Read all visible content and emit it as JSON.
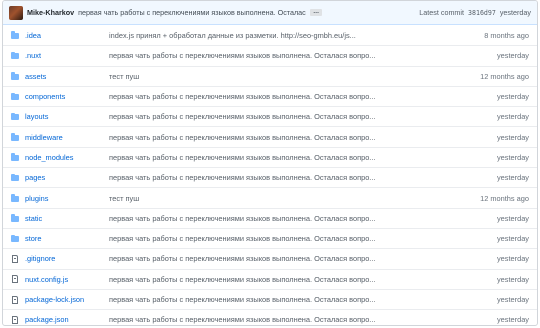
{
  "commit": {
    "author": "Mike-Kharkov",
    "message": "первая чать работы с переключениями языков выполнена. Осталася вопро...",
    "more_label": "…",
    "latest_label": "Latest commit",
    "sha": "3816d97",
    "when": "yesterday"
  },
  "files": [
    {
      "type": "dir",
      "name": ".idea",
      "message": "index.js принял + обработал данные из разметки. http://seo-gmbh.eu/js...",
      "age": "8 months ago"
    },
    {
      "type": "dir",
      "name": ".nuxt",
      "message": "первая чать работы с переключениями языков выполнена. Осталася вопро...",
      "age": "yesterday"
    },
    {
      "type": "dir",
      "name": "assets",
      "message": "тест пуш",
      "age": "12 months ago"
    },
    {
      "type": "dir",
      "name": "components",
      "message": "первая чать работы с переключениями языков выполнена. Осталася вопро...",
      "age": "yesterday"
    },
    {
      "type": "dir",
      "name": "layouts",
      "message": "первая чать работы с переключениями языков выполнена. Осталася вопро...",
      "age": "yesterday"
    },
    {
      "type": "dir",
      "name": "middleware",
      "message": "первая чать работы с переключениями языков выполнена. Осталася вопро...",
      "age": "yesterday"
    },
    {
      "type": "dir",
      "name": "node_modules",
      "message": "первая чать работы с переключениями языков выполнена. Осталася вопро...",
      "age": "yesterday"
    },
    {
      "type": "dir",
      "name": "pages",
      "message": "первая чать работы с переключениями языков выполнена. Осталася вопро...",
      "age": "yesterday"
    },
    {
      "type": "dir",
      "name": "plugins",
      "message": "тест пуш",
      "age": "12 months ago"
    },
    {
      "type": "dir",
      "name": "static",
      "message": "первая чать работы с переключениями языков выполнена. Осталася вопро...",
      "age": "yesterday"
    },
    {
      "type": "dir",
      "name": "store",
      "message": "первая чать работы с переключениями языков выполнена. Осталася вопро...",
      "age": "yesterday"
    },
    {
      "type": "file",
      "name": ".gitignore",
      "message": "первая чать работы с переключениями языков выполнена. Осталася вопро...",
      "age": "yesterday"
    },
    {
      "type": "file",
      "name": "nuxt.config.js",
      "message": "первая чать работы с переключениями языков выполнена. Осталася вопро...",
      "age": "yesterday"
    },
    {
      "type": "file",
      "name": "package-lock.json",
      "message": "первая чать работы с переключениями языков выполнена. Осталася вопро...",
      "age": "yesterday"
    },
    {
      "type": "file",
      "name": "package.json",
      "message": "первая чать работы с переключениями языков выполнена. Осталася вопро...",
      "age": "yesterday"
    }
  ],
  "icons": {
    "dir": "folder-icon",
    "file": "file-icon"
  },
  "colors": {
    "link": "#0366d6",
    "folder": "#79b8ff",
    "commit_bar": "#f1f8ff"
  }
}
